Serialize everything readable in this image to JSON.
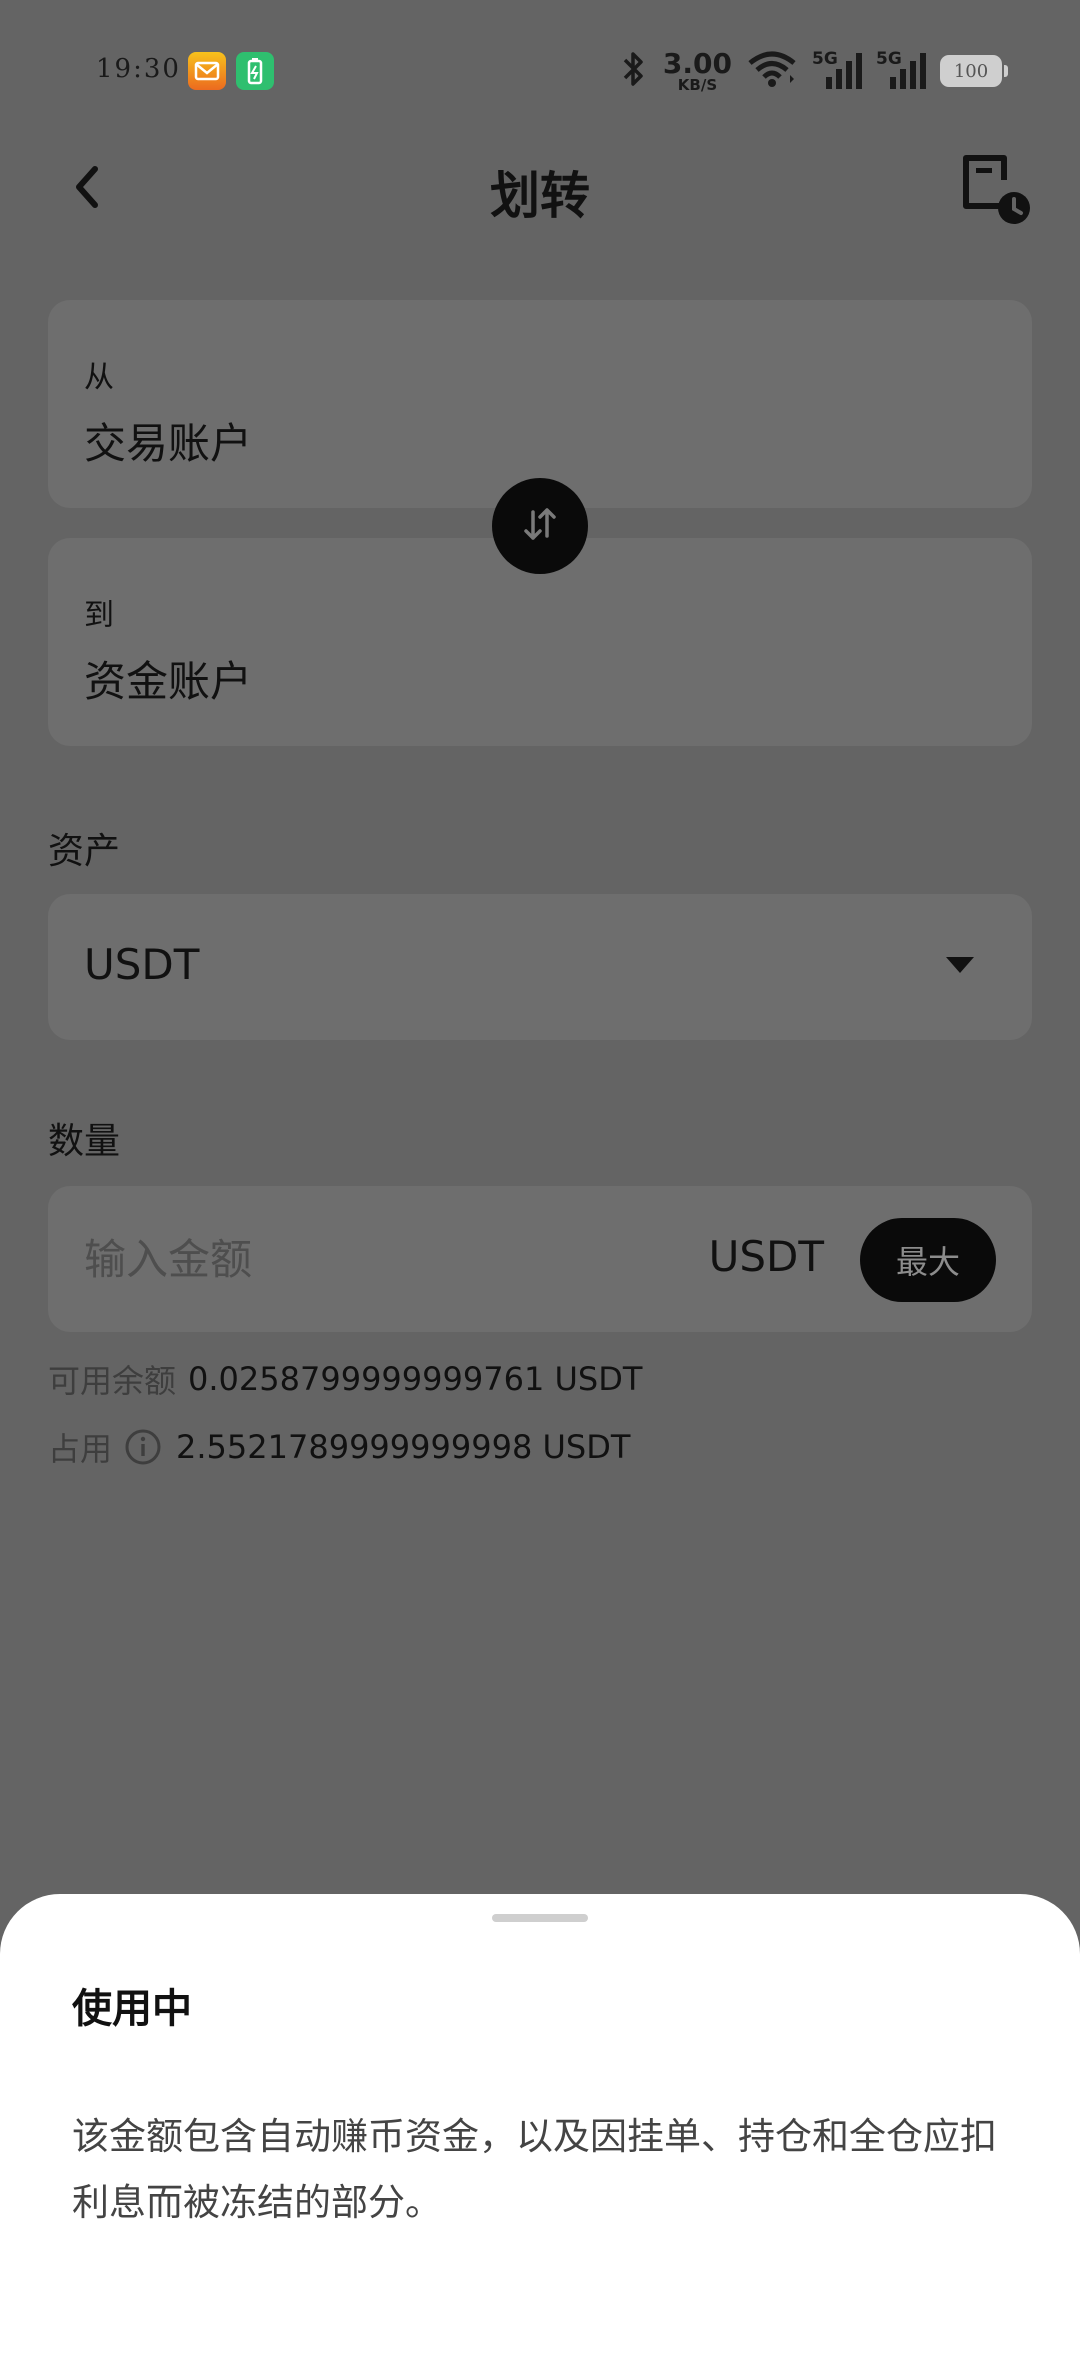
{
  "status_bar": {
    "time": "19:30",
    "notifications": [
      "mail-notification-icon",
      "battery-saver-icon"
    ],
    "net_speed_value": "3.00",
    "net_speed_unit": "KB/S",
    "signal1_label": "5G",
    "signal2_label": "5G",
    "battery": "100"
  },
  "header": {
    "title": "划转",
    "back_icon": "chevron-left-icon",
    "history_icon": "record-clock-icon"
  },
  "transfer": {
    "from_label": "从",
    "from_value": "交易账户",
    "to_label": "到",
    "to_value": "资金账户",
    "swap_icon": "swap-arrows-icon"
  },
  "asset": {
    "label": "资产",
    "selected": "USDT"
  },
  "amount": {
    "label": "数量",
    "placeholder": "输入金额",
    "unit": "USDT",
    "max_label": "最大"
  },
  "balances": {
    "available_label": "可用余额",
    "available_value": "0.0258799999999761 USDT",
    "occupied_label": "占用",
    "occupied_value": "2.5521789999999998 USDT"
  },
  "sheet": {
    "title": "使用中",
    "body": "该金额包含自动赚币资金，以及因挂单、持仓和全仓应扣利息而被冻结的部分。"
  },
  "colors": {
    "overlay_background": "#646464",
    "card_background": "#6e6e6e",
    "button_black": "#0a0a0a",
    "sheet_background": "#ffffff"
  }
}
